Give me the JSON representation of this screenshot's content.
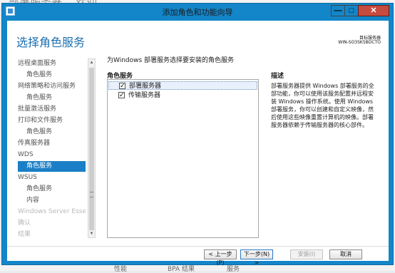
{
  "background": {
    "top_title": "部署服务器... 欢迎 ...",
    "bottom_items": [
      "性能",
      "BPA 结果",
      "服务"
    ]
  },
  "window": {
    "title": "添加角色和功能向导",
    "minimize_glyph": "—",
    "maximize_glyph": "□",
    "close_glyph": "✕"
  },
  "page": {
    "heading": "选择角色服务",
    "dest_label": "目标服务器",
    "dest_server": "WIN-SO3SK5BDCTO"
  },
  "nav": {
    "items": [
      {
        "label": "远程桌面服务",
        "level": 0,
        "state": "normal"
      },
      {
        "label": "角色服务",
        "level": 1,
        "state": "normal"
      },
      {
        "label": "网络策略和访问服务",
        "level": 0,
        "state": "normal"
      },
      {
        "label": "角色服务",
        "level": 1,
        "state": "normal"
      },
      {
        "label": "批量激活服务",
        "level": 0,
        "state": "normal"
      },
      {
        "label": "打印和文件服务",
        "level": 0,
        "state": "normal"
      },
      {
        "label": "角色服务",
        "level": 1,
        "state": "normal"
      },
      {
        "label": "传真服务器",
        "level": 0,
        "state": "normal"
      },
      {
        "label": "WDS",
        "level": 0,
        "state": "normal"
      },
      {
        "label": "角色服务",
        "level": 1,
        "state": "active"
      },
      {
        "label": "WSUS",
        "level": 0,
        "state": "normal"
      },
      {
        "label": "角色服务",
        "level": 1,
        "state": "normal"
      },
      {
        "label": "内容",
        "level": 1,
        "state": "normal"
      },
      {
        "label": "Windows Server Esse...",
        "level": 0,
        "state": "disabled"
      },
      {
        "label": "确认",
        "level": 0,
        "state": "disabled"
      },
      {
        "label": "结果",
        "level": 0,
        "state": "disabled"
      }
    ],
    "scroll_up": "▲",
    "scroll_down": "▼"
  },
  "main": {
    "intro": "为Windows 部署服务选择要安装的角色服务",
    "roles_label": "角色服务",
    "roles": [
      {
        "label": "部署服务器",
        "checked": true,
        "selected": true
      },
      {
        "label": "传输服务器",
        "checked": true,
        "selected": false
      }
    ],
    "check_glyph": "✓",
    "desc_label": "描述",
    "desc_text": "部署服务器提供 Windows 部署服务的全部功能，你可以使用该服务配置并远程安装 Windows 操作系统。使用 Windows 部署服务，你可以创建和自定义映像，然后使用这些映像重置计算机的映像。部署服务器依赖于传输服务器的核心部件。"
  },
  "footer": {
    "prev": "< 上一步(P)",
    "next": "下一步(N) >",
    "install": "安装(I)",
    "cancel": "取消"
  },
  "colors": {
    "accent": "#1386c9",
    "heading": "#1c6fb0",
    "nav_active": "#1a7fc6"
  }
}
